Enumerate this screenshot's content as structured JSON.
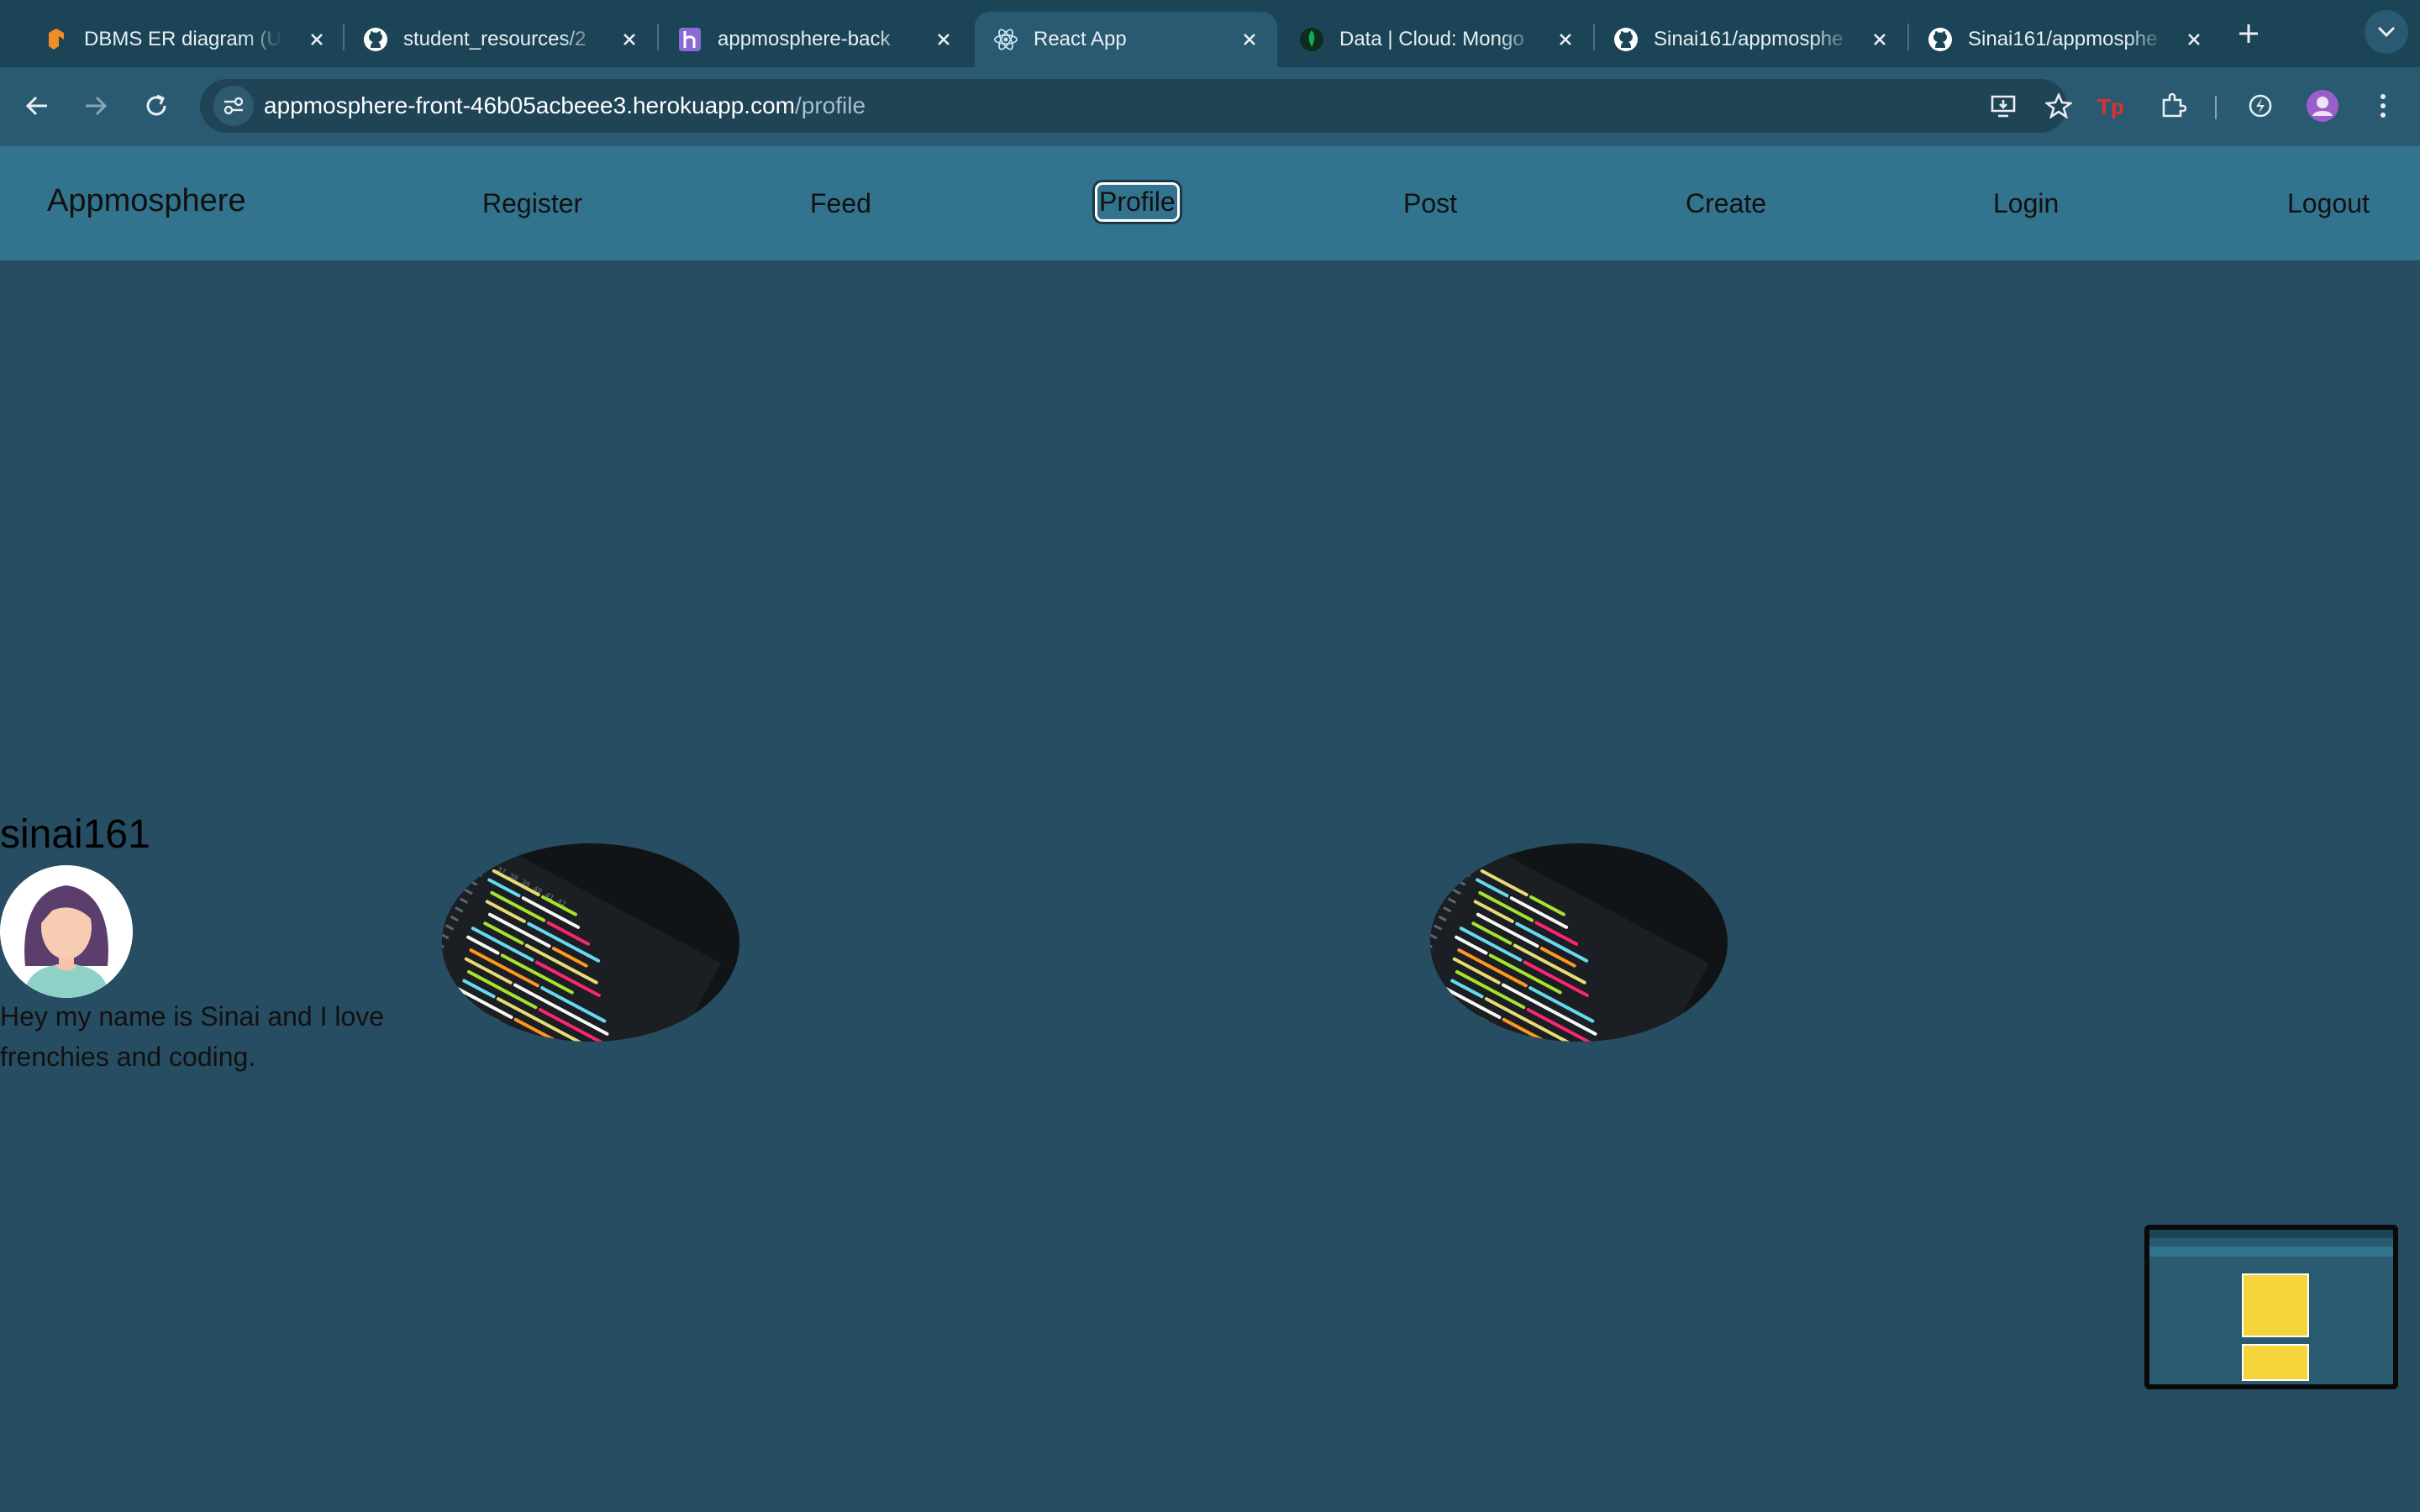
{
  "browser": {
    "tabs": [
      {
        "title": "DBMS ER diagram (U",
        "favicon": "lucidchart-icon",
        "active": false
      },
      {
        "title": "student_resources/2",
        "favicon": "github-icon",
        "active": false
      },
      {
        "title": "appmosphere-back",
        "favicon": "heroku-icon",
        "active": false
      },
      {
        "title": "React App",
        "favicon": "react-icon",
        "active": true
      },
      {
        "title": "Data | Cloud: Mongo",
        "favicon": "mongodb-icon",
        "active": false
      },
      {
        "title": "Sinai161/appmosphe",
        "favicon": "github-icon",
        "active": false
      },
      {
        "title": "Sinai161/appmosphe",
        "favicon": "github-icon",
        "active": false
      }
    ],
    "url_host": "appmosphere-front-46b05acbeee3.herokuapp.com",
    "url_path": "/profile"
  },
  "nav": {
    "brand": "Appmosphere",
    "links": [
      "Register",
      "Feed",
      "Profile",
      "Post",
      "Create",
      "Login",
      "Logout"
    ],
    "active": "Profile"
  },
  "profile": {
    "username": "sinai161",
    "bio": "Hey my name is Sinai and I love frenchies and coding."
  },
  "colors": {
    "page_bg": "#264d62",
    "navbar_bg": "#32748e",
    "tabbar_bg": "#1c4457",
    "toolbar_bg": "#2a5a72"
  }
}
